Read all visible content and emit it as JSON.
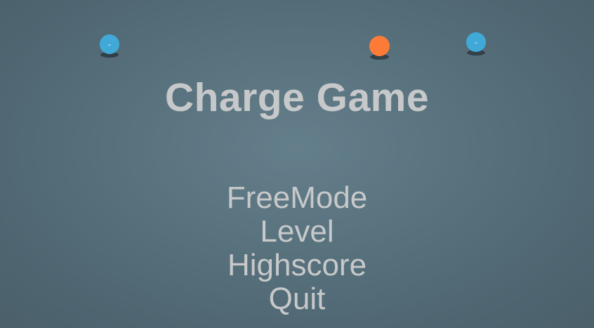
{
  "game": {
    "title": "Charge Game",
    "menu": {
      "items": [
        {
          "label": "FreeMode"
        },
        {
          "label": "Level"
        },
        {
          "label": "Highscore"
        },
        {
          "label": "Quit"
        }
      ]
    },
    "particles": [
      {
        "charge_label": "-",
        "color": "#41a9d8",
        "type": "negative"
      },
      {
        "charge_label": "",
        "color": "#fd7b37",
        "type": "positive"
      },
      {
        "charge_label": "-",
        "color": "#41a9d8",
        "type": "negative"
      }
    ]
  },
  "colors": {
    "background_center": "#647f8b",
    "background_edge": "#4a5f6a",
    "text": "#c7c8c9",
    "negative_charge": "#41a9d8",
    "positive_charge": "#fd7b37"
  }
}
